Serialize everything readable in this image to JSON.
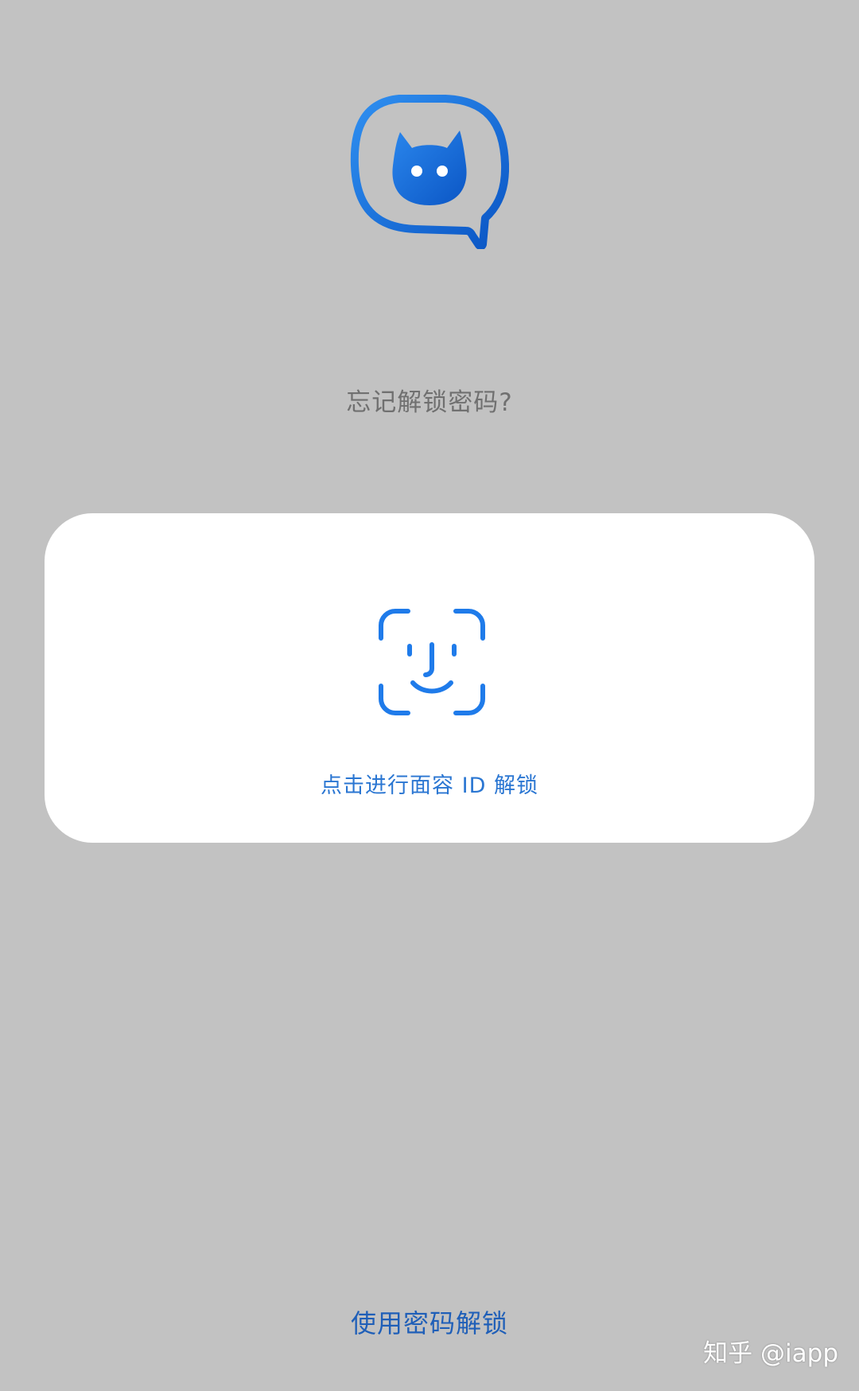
{
  "app": {
    "logo_icon": "chat-bubble-cat-logo",
    "brand_color": "#1a6fd6"
  },
  "lock_screen": {
    "forgot_password_label": "忘记解锁密码?",
    "face_id_icon": "face-id-icon",
    "face_id_label": "点击进行面容 ID 解锁",
    "password_unlock_label": "使用密码解锁"
  },
  "watermark": {
    "text": "知乎 @iapp"
  },
  "colors": {
    "background": "#c2c2c2",
    "card": "#ffffff",
    "accent": "#2a76d2",
    "muted_text": "#707070"
  }
}
